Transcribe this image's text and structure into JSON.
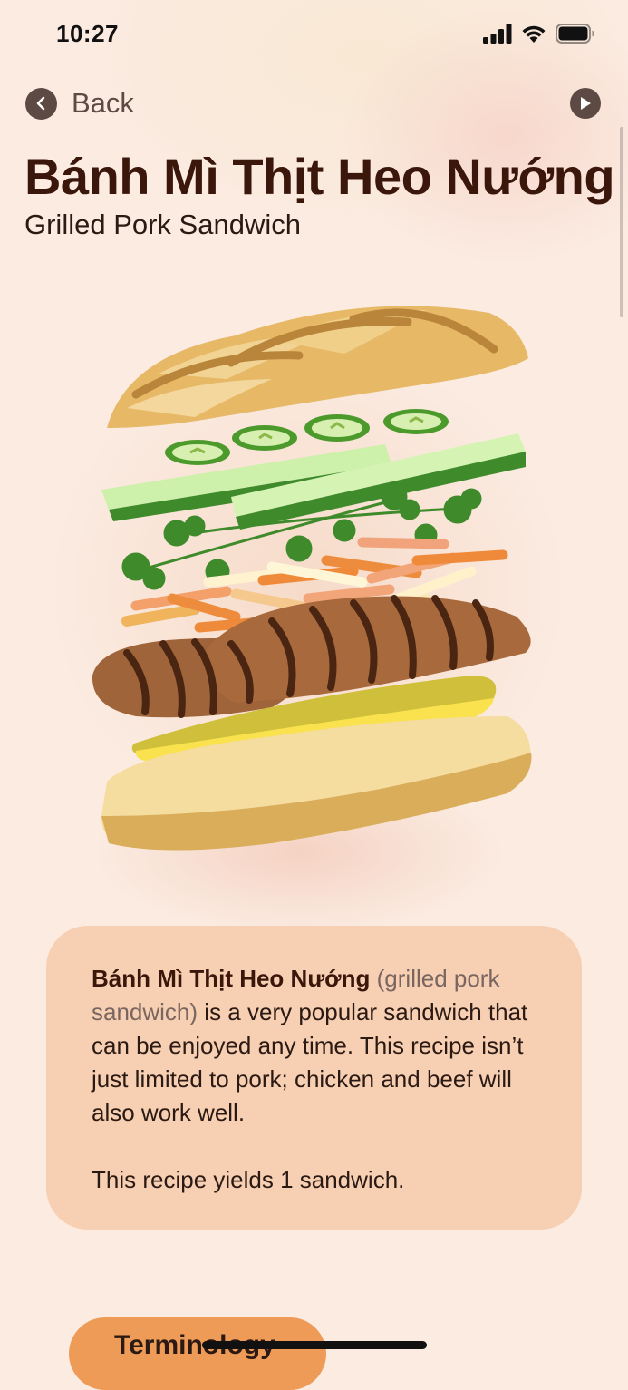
{
  "status_bar": {
    "time": "10:27"
  },
  "nav": {
    "back_label": "Back"
  },
  "recipe": {
    "title": "Bánh Mì Thịt Heo Nướng",
    "subtitle": "Grilled Pork Sandwich",
    "description": {
      "name": "Bánh Mì Thịt Heo Nướng",
      "translation": "(grilled pork sandwich)",
      "body": "is a very popular sandwich that can be enjoyed any time. This recipe isn’t just limited to pork; chicken and beef will also work well.",
      "yield": "This recipe yields 1 sandwich."
    }
  },
  "buttons": {
    "terminology": "Terminology"
  },
  "colors": {
    "background": "#fbebe1",
    "title": "#3a160b",
    "card": "#f7cfb2",
    "accent_button": "#ee9b58",
    "control": "#5d4a45"
  },
  "icons": [
    "cellular-signal-icon",
    "wifi-icon",
    "battery-icon",
    "chevron-left-icon",
    "play-icon"
  ]
}
